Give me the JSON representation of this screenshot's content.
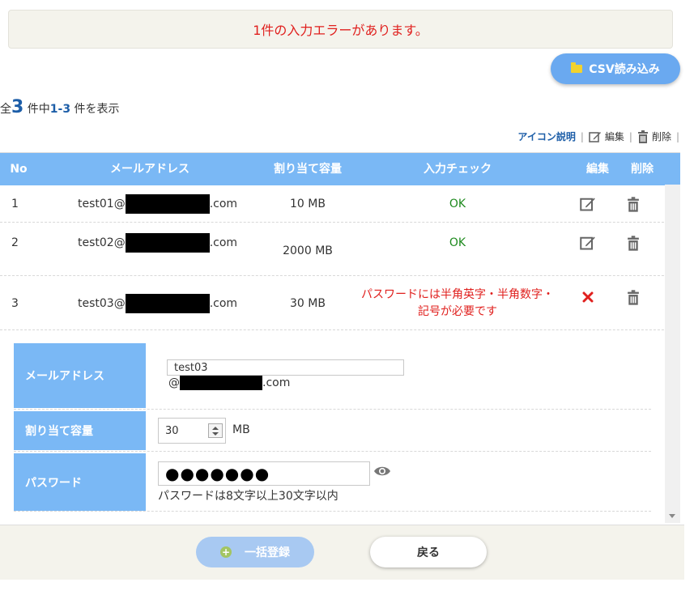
{
  "error_message": "1件の入力エラーがあります。",
  "csv_button": "CSV読み込み",
  "count": {
    "prefix": "全",
    "total": "3",
    "mid": "件中",
    "range": "1-3",
    "suffix": "件を表示"
  },
  "legend": {
    "icon_help": "アイコン説明",
    "edit": "編集",
    "delete": "削除",
    "sep": "|"
  },
  "table": {
    "headers": {
      "no": "No",
      "mail": "メールアドレス",
      "capacity": "割り当て容量",
      "check": "入力チェック",
      "edit": "編集",
      "delete": "削除"
    },
    "rows": [
      {
        "no": "1",
        "mail_user": "test01@",
        "mail_domain": ".com",
        "capacity": "10 MB",
        "check": "OK",
        "status": "ok"
      },
      {
        "no": "2",
        "mail_user": "test02@",
        "mail_domain": ".com",
        "capacity": "2000 MB",
        "check": "OK",
        "status": "ok"
      },
      {
        "no": "3",
        "mail_user": "test03@",
        "mail_domain": ".com",
        "capacity": "30 MB",
        "check": "パスワードには半角英字・半角数字・記号が必要です",
        "status": "error"
      }
    ]
  },
  "detail": {
    "mail_label": "メールアドレス",
    "mail_value": "test03",
    "mail_at": "@",
    "mail_domain": ".com",
    "capacity_label": "割り当て容量",
    "capacity_value": "30",
    "capacity_unit": "MB",
    "password_label": "パスワード",
    "password_value": "●●●●●●●",
    "password_hint": "パスワードは8文字以上30文字以内"
  },
  "footer": {
    "register": "一括登録",
    "back": "戻る"
  },
  "colors": {
    "accent": "#7ab8f5",
    "error": "#e0201e",
    "ok": "#1e8a1e",
    "link": "#1d5ea8"
  }
}
